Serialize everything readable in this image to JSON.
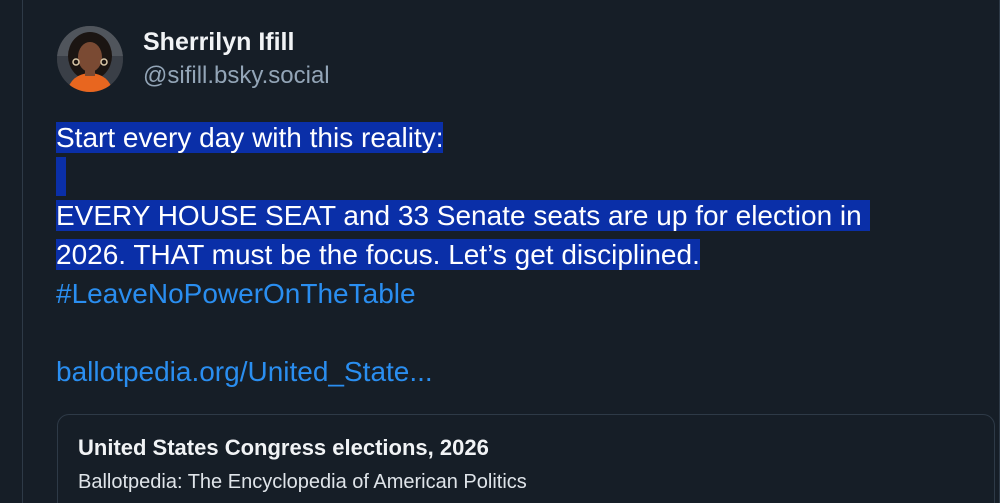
{
  "author": {
    "display_name": "Sherrilyn Ifill",
    "handle": "@sifill.bsky.social",
    "avatar_icon": "profile-photo-icon"
  },
  "post": {
    "line1": "Start every day with this reality:",
    "line2": "EVERY HOUSE SEAT and 33 Senate seats are up for election in ",
    "line3": "2026. THAT must be the focus. Let’s get disciplined.",
    "hashtag": "#LeaveNoPowerOnTheTable",
    "link": "ballotpedia.org/United_State..."
  },
  "link_card": {
    "title": "United States Congress elections, 2026",
    "description": "Ballotpedia: The Encyclopedia of American Politics"
  },
  "colors": {
    "background": "#161e27",
    "selection": "#0a2fa8",
    "link": "#2a8ef0",
    "handle": "#93a5b7"
  }
}
